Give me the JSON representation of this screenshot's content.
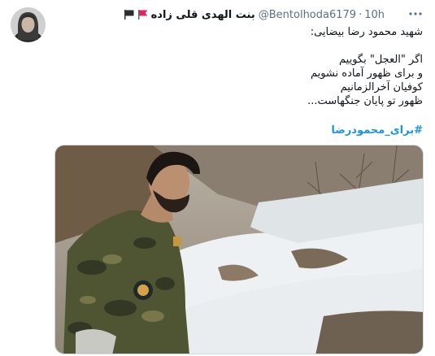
{
  "tweet": {
    "author_name": "بنت الهدی قلی زاده",
    "handle": "@Bentolhoda6179",
    "separator": "·",
    "time": "10h",
    "lines": [
      "شهید محمود رضا بیضایی:",
      "",
      "اگر \"العجل\" بگوییم",
      "و برای ظهور آماده نشویم",
      "کوفیان آخرالزمانیم",
      "ظهور تو پایان جنگهاست..."
    ],
    "hashtag": "#برای_محمودرضا"
  },
  "icons": {
    "more": "more-options-icon",
    "flag_black": "black-flag-icon",
    "flag_red": "red-flag-icon"
  },
  "colors": {
    "link": "#1b95e0",
    "secondary_text": "#5b7083",
    "red_flag": "#e0245e"
  }
}
